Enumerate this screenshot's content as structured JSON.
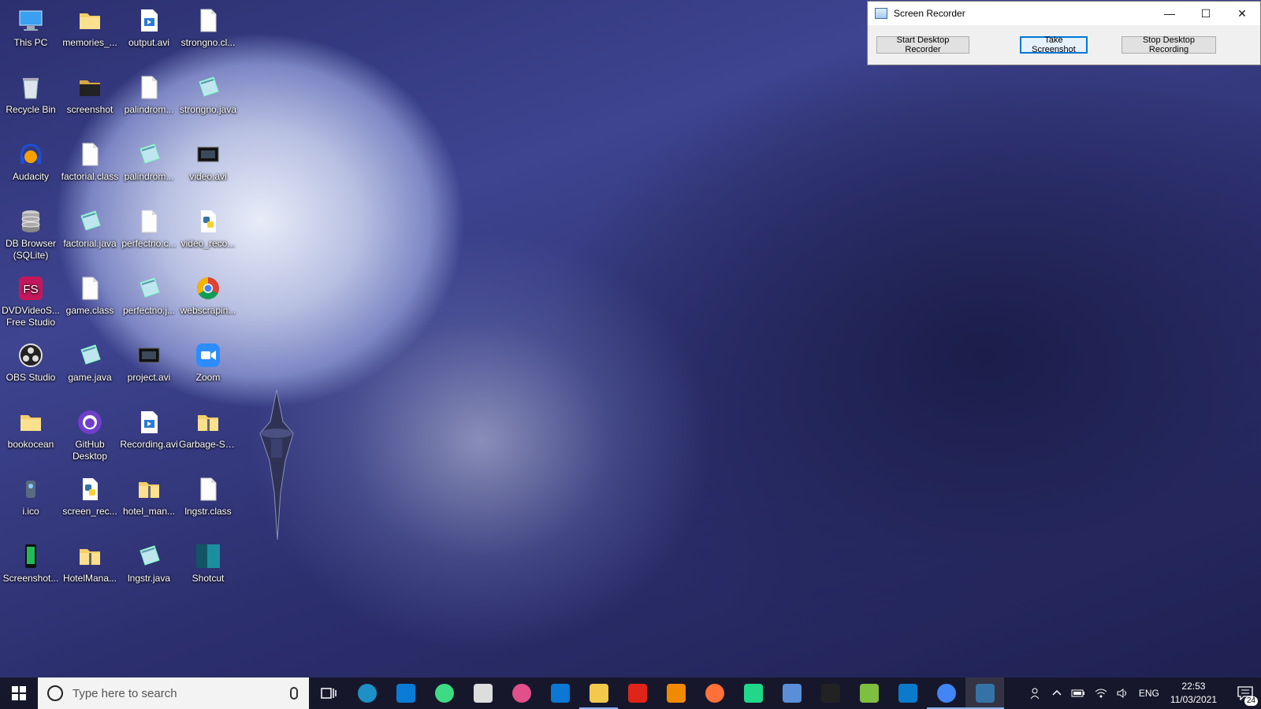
{
  "window": {
    "title": "Screen Recorder",
    "minimize": "—",
    "maximize": "☐",
    "close": "✕",
    "buttons": {
      "start": "Start Desktop Recorder",
      "screenshot": "Take Screenshot",
      "stop": "Stop Desktop Recording"
    }
  },
  "desktop_icons": [
    {
      "label": "This PC"
    },
    {
      "label": "memories_..."
    },
    {
      "label": "output.avi"
    },
    {
      "label": "strongno.cl..."
    },
    {
      "label": "Recycle Bin"
    },
    {
      "label": "screenshot"
    },
    {
      "label": "palindrom..."
    },
    {
      "label": "strongno.java"
    },
    {
      "label": "Audacity"
    },
    {
      "label": "factorial.class"
    },
    {
      "label": "palindrom..."
    },
    {
      "label": "video.avi"
    },
    {
      "label": "DB Browser",
      "label2": "(SQLite)"
    },
    {
      "label": "factorial.java"
    },
    {
      "label": "perfectno.c..."
    },
    {
      "label": "video_reco..."
    },
    {
      "label": "DVDVideoS...",
      "label2": "Free Studio"
    },
    {
      "label": "game.class"
    },
    {
      "label": "perfectno.j..."
    },
    {
      "label": "webscrapin..."
    },
    {
      "label": "OBS Studio"
    },
    {
      "label": "game.java"
    },
    {
      "label": "project.avi"
    },
    {
      "label": "Zoom"
    },
    {
      "label": "bookocean"
    },
    {
      "label": "GitHub",
      "label2": "Desktop"
    },
    {
      "label": "Recording.avi"
    },
    {
      "label": "Garbage-Se..."
    },
    {
      "label": "i.ico"
    },
    {
      "label": "screen_rec..."
    },
    {
      "label": "hotel_man..."
    },
    {
      "label": "lngstr.class"
    },
    {
      "label": "Screenshot..."
    },
    {
      "label": "HotelMana..."
    },
    {
      "label": "lngstr.java"
    },
    {
      "label": "Shotcut"
    }
  ],
  "taskbar": {
    "search_placeholder": "Type here to search",
    "apps": [
      "Task View",
      "Microsoft Edge",
      "Microsoft Store",
      "Android Studio",
      "Reader",
      "Paint 3D",
      "Mail",
      "File Explorer",
      "Adobe Acrobat",
      "VLC",
      "Firefox",
      "PyCharm",
      "Gallery",
      "Command Prompt",
      "Notepad",
      "Visual Studio Code",
      "Google Chrome",
      "Python"
    ],
    "tray": {
      "language": "ENG",
      "time": "22:53",
      "date": "11/03/2021",
      "notifications": "24"
    }
  },
  "colors": {
    "taskbar": "#16162a",
    "focus_blue": "#0078d7",
    "folder": "#f4cf6a"
  }
}
